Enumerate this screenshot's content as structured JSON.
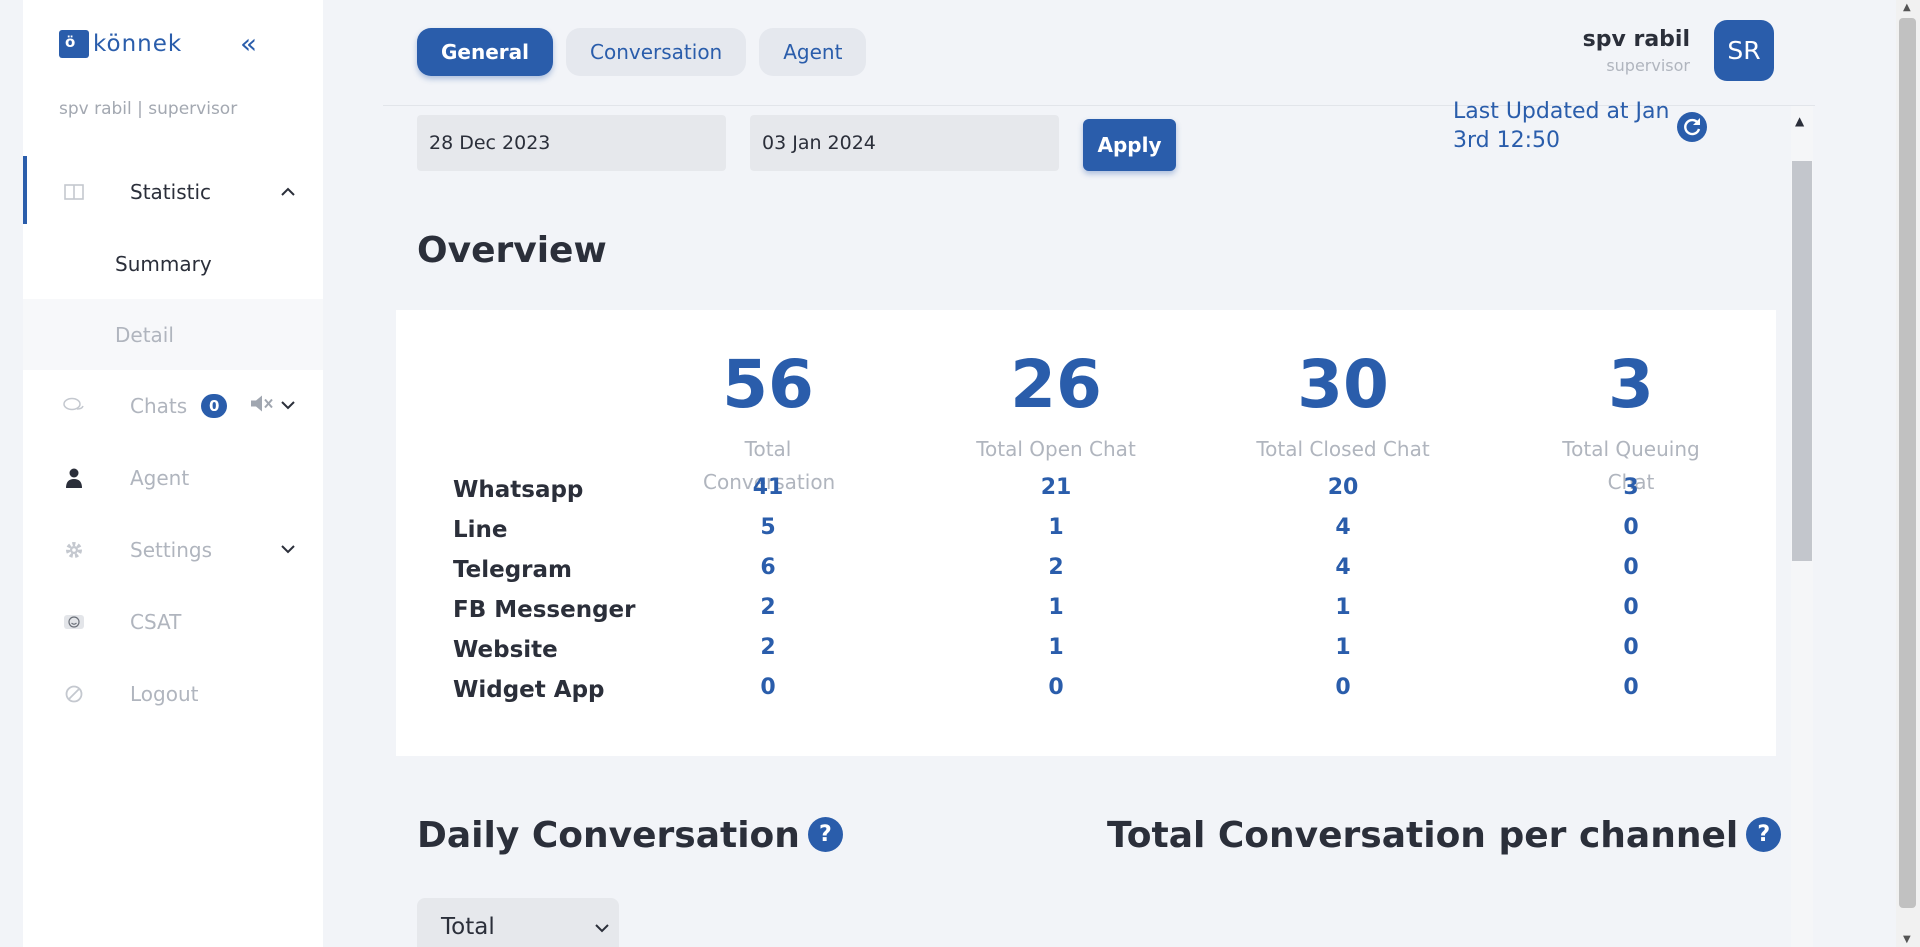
{
  "brand": {
    "name": "könnek",
    "mark": "ö"
  },
  "sidebar": {
    "user_line": "spv rabil | supervisor",
    "items": [
      {
        "label": "Statistic",
        "icon": "columns-icon"
      },
      {
        "label": "Chats",
        "icon": "chat-bubbles-icon",
        "badge": "0"
      },
      {
        "label": "Agent",
        "icon": "person-icon"
      },
      {
        "label": "Settings",
        "icon": "gear-icon"
      },
      {
        "label": "CSAT",
        "icon": "smiley-icon"
      },
      {
        "label": "Logout",
        "icon": "logout-icon"
      }
    ],
    "sub_items": [
      {
        "label": "Summary"
      },
      {
        "label": "Detail"
      }
    ]
  },
  "header": {
    "tabs": [
      {
        "label": "General"
      },
      {
        "label": "Conversation"
      },
      {
        "label": "Agent"
      }
    ],
    "user_name": "spv rabil",
    "user_role": "supervisor",
    "avatar_initials": "SR"
  },
  "filters": {
    "start_date": "28 Dec 2023",
    "end_date": "03 Jan 2024",
    "apply_label": "Apply",
    "last_updated": "Last Updated at Jan 3rd 12:50"
  },
  "overview": {
    "title": "Overview",
    "stats": [
      {
        "value": "56",
        "label": "Total Conversation"
      },
      {
        "value": "26",
        "label": "Total Open Chat"
      },
      {
        "value": "30",
        "label": "Total Closed Chat"
      },
      {
        "value": "3",
        "label": "Total Queuing Chat"
      }
    ],
    "channels": [
      {
        "name": "Whatsapp",
        "values": [
          "41",
          "21",
          "20",
          "3"
        ]
      },
      {
        "name": "Line",
        "values": [
          "5",
          "1",
          "4",
          "0"
        ]
      },
      {
        "name": "Telegram",
        "values": [
          "6",
          "2",
          "4",
          "0"
        ]
      },
      {
        "name": "FB Messenger",
        "values": [
          "2",
          "1",
          "1",
          "0"
        ]
      },
      {
        "name": "Website",
        "values": [
          "2",
          "1",
          "1",
          "0"
        ]
      },
      {
        "name": "Widget App",
        "values": [
          "0",
          "0",
          "0",
          "0"
        ]
      }
    ]
  },
  "daily": {
    "title": "Daily Conversation",
    "select_value": "Total"
  },
  "per_channel": {
    "title": "Total Conversation per channel"
  },
  "colors": {
    "accent": "#2a5dab",
    "background": "#f2f4f8",
    "muted": "#b0b5be"
  }
}
